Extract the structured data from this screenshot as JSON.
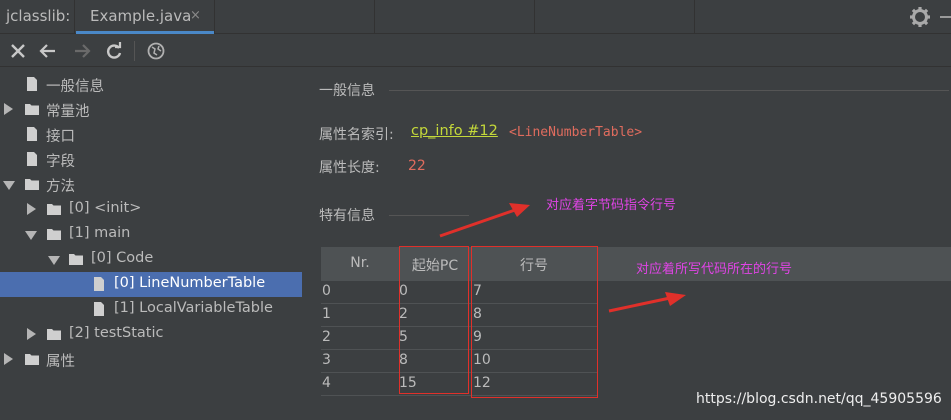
{
  "tabbar": {
    "project": "jclasslib:",
    "tab_label": "Example.java",
    "close_glyph": "×"
  },
  "toolbar": {
    "icons": [
      "close-icon",
      "back-arrow-icon",
      "forward-arrow-icon",
      "refresh-icon",
      "browser-icon"
    ]
  },
  "tree": {
    "items": [
      {
        "label": "一般信息",
        "icon": "file-icon"
      },
      {
        "label": "常量池",
        "icon": "folder-icon",
        "expanded": false
      },
      {
        "label": "接口",
        "icon": "file-icon"
      },
      {
        "label": "字段",
        "icon": "file-icon"
      },
      {
        "label": "方法",
        "icon": "folder-icon",
        "expanded": true
      },
      {
        "label": "[0] <init>",
        "icon": "folder-icon",
        "expanded": false
      },
      {
        "label": "[1] main",
        "icon": "folder-icon",
        "expanded": true
      },
      {
        "label": "[0] Code",
        "icon": "folder-icon",
        "expanded": true
      },
      {
        "label": "[0] LineNumberTable",
        "icon": "file-icon",
        "selected": true
      },
      {
        "label": "[1] LocalVariableTable",
        "icon": "file-icon"
      },
      {
        "label": "[2] testStatic",
        "icon": "folder-icon",
        "expanded": false
      },
      {
        "label": "属性",
        "icon": "folder-icon",
        "expanded": false
      }
    ]
  },
  "panel": {
    "general_title": "一般信息",
    "name_index_label": "属性名索引:",
    "name_index_link": "cp_info #12",
    "name_index_value": "<LineNumberTable>",
    "length_label": "属性长度:",
    "length_value": "22",
    "specific_title": "特有信息"
  },
  "table": {
    "columns": [
      "Nr.",
      "起始PC",
      "行号"
    ],
    "rows": [
      [
        "0",
        "0",
        "7"
      ],
      [
        "1",
        "2",
        "8"
      ],
      [
        "2",
        "5",
        "9"
      ],
      [
        "3",
        "8",
        "10"
      ],
      [
        "4",
        "15",
        "12"
      ]
    ]
  },
  "annotations": {
    "note_pc": "对应着字节码指令行号",
    "note_line": "对应着所写代码所在的行号",
    "color": "#e044e6",
    "box_color": "#e0302a"
  },
  "watermark": "https://blog.csdn.net/qq_45905596",
  "colors": {
    "background": "#3c3f41",
    "selection": "#4b6eaf",
    "tab_underline": "#4a88c7",
    "link": "#c4d83a",
    "value_red": "#e06c5e"
  }
}
